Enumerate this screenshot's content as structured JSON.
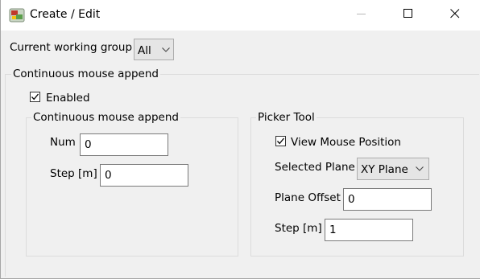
{
  "window": {
    "title": "Create / Edit"
  },
  "working_group": {
    "label": "Current working group",
    "selected": "All"
  },
  "continuous_append_outer": {
    "label": "Continuous mouse append",
    "enabled_label": "Enabled",
    "enabled_checked": true
  },
  "continuous_append_inner": {
    "label": "Continuous mouse append",
    "num_label": "Num",
    "num_value": "0",
    "step_label": "Step [m]",
    "step_value": "0"
  },
  "picker_tool": {
    "label": "Picker Tool",
    "view_mouse_label": "View Mouse Position",
    "view_mouse_checked": true,
    "plane_label": "Selected Plane",
    "plane_selected": "XY Plane",
    "offset_label": "Plane Offset",
    "offset_value": "0",
    "step_label": "Step [m]",
    "step_value": "1"
  },
  "icons": {
    "app": "app-logo-icon",
    "minimize": "minimize-icon",
    "maximize": "maximize-icon",
    "close": "close-icon",
    "dropdown": "chevron-down-icon",
    "check": "checkmark-icon"
  }
}
